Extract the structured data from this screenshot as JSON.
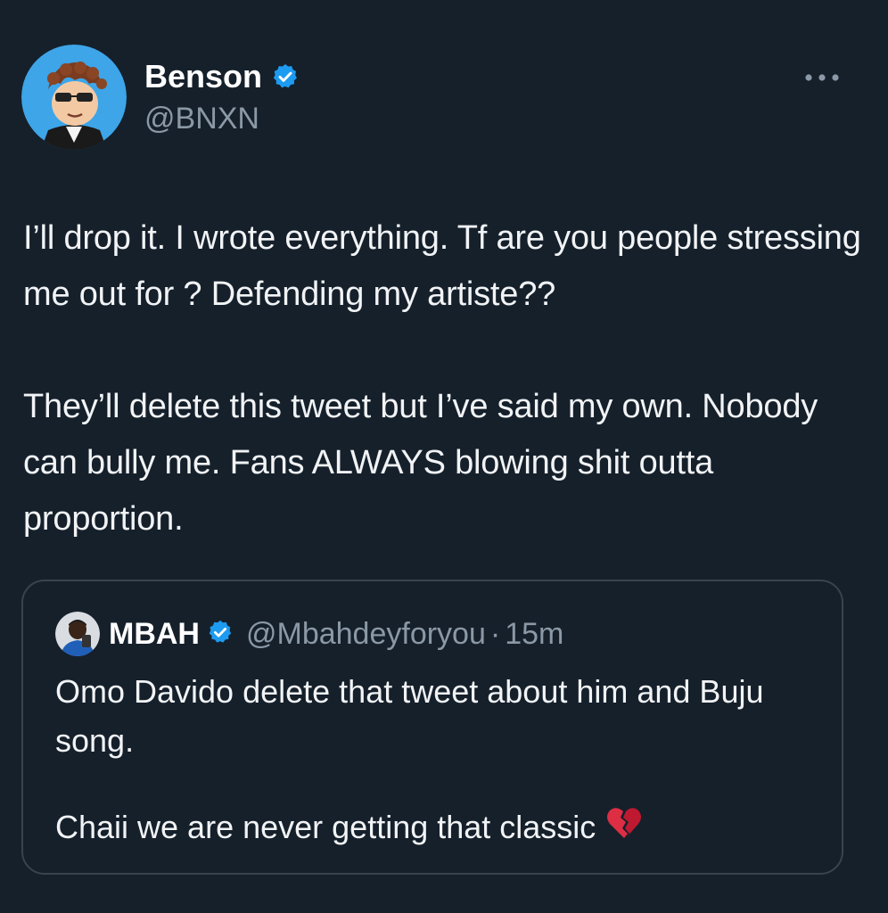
{
  "author": {
    "display_name": "Benson",
    "handle": "@BNXN",
    "verified": true,
    "avatar_icon": "cartoon-avatar"
  },
  "tweet": {
    "text": "I’ll drop it. I wrote everything. Tf are you people stressing me out for ? Defending my artiste??\n\nThey’ll delete this tweet but I’ve said my own. Nobody can bully me. Fans ALWAYS blowing shit outta proportion."
  },
  "quoted_tweet": {
    "display_name": "MBAH",
    "handle": "@Mbahdeyforyou",
    "separator": "·",
    "time": "15m",
    "verified": true,
    "text": "Omo Davido delete that tweet about him and Buju song.",
    "last_line": "Chaii we are never getting that classic",
    "emoji": "broken-heart"
  },
  "colors": {
    "background": "#15202b",
    "verified": "#1d9bf0",
    "secondary_text": "#8b98a5",
    "border": "#38444d"
  }
}
